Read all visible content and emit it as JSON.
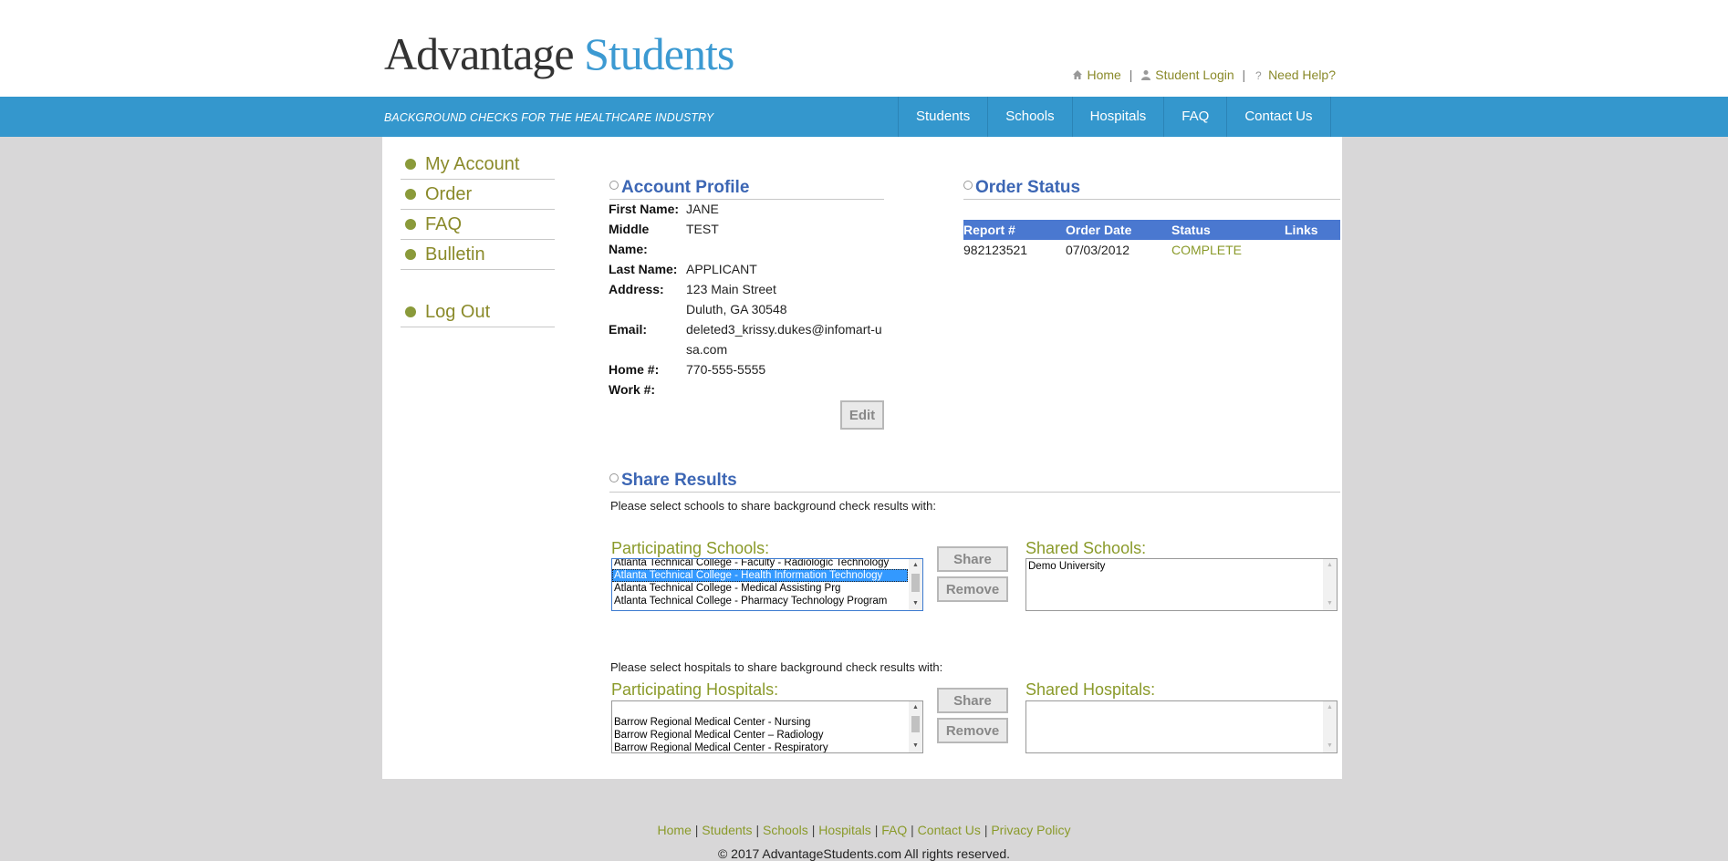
{
  "logo": {
    "word1": "Advantage",
    "word2": "Students"
  },
  "top_links": {
    "home": "Home",
    "student_login": "Student Login",
    "need_help": "Need Help?",
    "separator": "|"
  },
  "tagline": "BACKGROUND CHECKS FOR THE HEALTHCARE INDUSTRY",
  "main_nav": [
    "Students",
    "Schools",
    "Hospitals",
    "FAQ",
    "Contact Us"
  ],
  "sidebar": {
    "items": [
      "My Account",
      "Order",
      "FAQ",
      "Bulletin"
    ],
    "logout": "Log Out"
  },
  "account_profile": {
    "title": "Account Profile",
    "fields": [
      {
        "label": "First Name:",
        "value": "JANE"
      },
      {
        "label": "Middle Name:",
        "value": "TEST"
      },
      {
        "label": "Last Name:",
        "value": "APPLICANT"
      },
      {
        "label": "Address:",
        "value": "123 Main Street",
        "value2": "Duluth, GA 30548"
      },
      {
        "label": "Email:",
        "value": "deleted3_krissy.dukes@infomart-usa.com"
      },
      {
        "label": "Home #:",
        "value": "770-555-5555"
      },
      {
        "label": "Work #:",
        "value": ""
      }
    ],
    "edit_label": "Edit"
  },
  "order_status": {
    "title": "Order Status",
    "columns": [
      "Report #",
      "Order Date",
      "Status",
      "Links"
    ],
    "rows": [
      {
        "report": "982123521",
        "date": "07/03/2012",
        "status": "COMPLETE",
        "links": ""
      }
    ]
  },
  "share_results": {
    "title": "Share Results",
    "schools_prompt": "Please select schools to share background check results with:",
    "participating_schools_label": "Participating Schools:",
    "participating_schools": [
      "Atlanta Technical College - Faculty - Radiologic Technology",
      "Atlanta Technical College - Health Information Technology",
      "Atlanta Technical College - Medical Assisting Prg",
      "Atlanta Technical College - Pharmacy Technology Program"
    ],
    "selected_school": "Atlanta Technical College - Health Information Technology",
    "shared_schools_label": "Shared Schools:",
    "shared_schools": [
      "Demo University"
    ],
    "share_label": "Share",
    "remove_label": "Remove",
    "hospitals_prompt": "Please select hospitals to share background check results with:",
    "participating_hospitals_label": "Participating Hospitals:",
    "participating_hospitals": [
      "",
      "Barrow Regional Medical Center - Nursing",
      "Barrow Regional Medical Center – Radiology",
      "Barrow Regional Medical Center - Respiratory"
    ],
    "shared_hospitals_label": "Shared Hospitals:",
    "shared_hospitals": []
  },
  "footer": {
    "links": [
      "Home",
      "Students",
      "Schools",
      "Hospitals",
      "FAQ",
      "Contact Us",
      "Privacy Policy"
    ],
    "separator": "|",
    "copyright": "© 2017 AdvantageStudents.com All rights reserved."
  }
}
